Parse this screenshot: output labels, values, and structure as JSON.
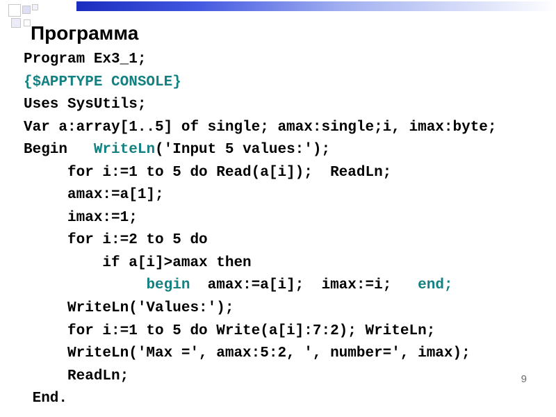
{
  "title": "Программа",
  "page_number": "9",
  "code": {
    "l1": "Program Ex3_1;",
    "l2": "{$APPTYPE CONSOLE}",
    "l3": "Uses SysUtils;",
    "l4": "Var a:array[1..5] of single; amax:single;i, imax:byte;",
    "l5a": "Begin   ",
    "l5b": "WriteLn",
    "l5c": "('Input 5 values:');",
    "l6": "     for i:=1 to 5 do Read(a[i]);  ReadLn;",
    "l7": "     amax:=a[1];",
    "l8": "     imax:=1;",
    "l9": "     for i:=2 to 5 do",
    "l10": "         if a[i]>amax then",
    "l11a": "              ",
    "l11b": "begin  ",
    "l11c": "amax:=a[i];  imax:=i;   ",
    "l11d": "end;",
    "l12": "     WriteLn('Values:');",
    "l13": "     for i:=1 to 5 do Write(a[i]:7:2); WriteLn;",
    "l14": "     WriteLn('Max =', amax:5:2, ', number=', imax);",
    "l15": "     ReadLn;",
    "l16": " End."
  }
}
